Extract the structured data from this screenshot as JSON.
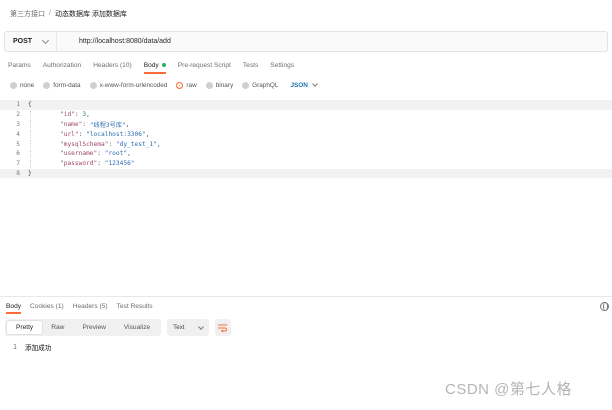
{
  "breadcrumb": {
    "parent": "第三方接口",
    "separator": "/",
    "current": "动态数据库 添加数据库"
  },
  "request": {
    "method": "POST",
    "url": "http://localhost:8080/data/add"
  },
  "request_tabs": [
    "Params",
    "Authorization",
    "Headers (10)",
    "Body",
    "Pre-request Script",
    "Tests",
    "Settings"
  ],
  "body_options": {
    "none": "none",
    "form_data": "form-data",
    "urlencoded": "x-www-form-urlencoded",
    "raw": "raw",
    "binary": "binary",
    "graphql": "GraphQL",
    "format": "JSON"
  },
  "editor": {
    "line_numbers": [
      "1",
      "2",
      "3",
      "4",
      "5",
      "6",
      "7",
      "8"
    ],
    "open_brace": "{",
    "close_brace": "}",
    "fields": [
      {
        "key": "\"id\"",
        "value": "3",
        "type": "num"
      },
      {
        "key": "\"name\"",
        "value": "\"线程3号库\"",
        "type": "str"
      },
      {
        "key": "\"url\"",
        "value": "\"localhost:3306\"",
        "type": "str"
      },
      {
        "key": "\"mysqlSchema\"",
        "value": "\"dy_test_1\"",
        "type": "str"
      },
      {
        "key": "\"username\"",
        "value": "\"root\"",
        "type": "str"
      },
      {
        "key": "\"password\"",
        "value": "\"123456\"",
        "type": "str"
      }
    ]
  },
  "response_tabs": [
    "Body",
    "Cookies (1)",
    "Headers (5)",
    "Test Results"
  ],
  "view_modes": [
    "Pretty",
    "Raw",
    "Preview",
    "Visualize"
  ],
  "response_format": "Text",
  "response": {
    "line": "1",
    "text": "添加成功"
  },
  "watermark": "CSDN @第七人格",
  "colors": {
    "accent": "#ff6c37",
    "status_ok": "#2fb34f",
    "json_blue": "#1a73b8"
  }
}
